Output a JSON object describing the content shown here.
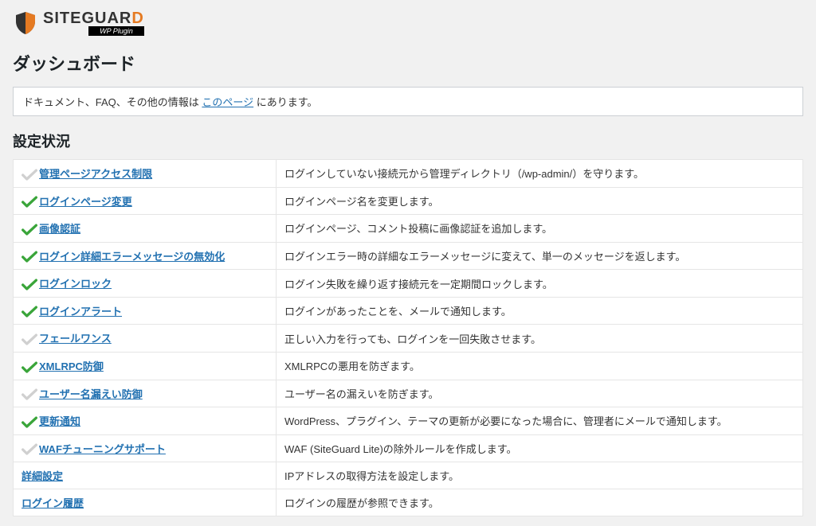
{
  "logo": {
    "brand_main": "SITEGUAR",
    "brand_accent": "D",
    "sub": "WP Plugin"
  },
  "page_title": "ダッシュボード",
  "help": {
    "prefix": "ドキュメント、FAQ、その他の情報は ",
    "link": "このページ",
    "suffix": " にあります。"
  },
  "section_title": "設定状況",
  "rows": [
    {
      "status": "off",
      "label": "管理ページアクセス制限",
      "desc": "ログインしていない接続元から管理ディレクトリ（/wp-admin/）を守ります。"
    },
    {
      "status": "on",
      "label": "ログインページ変更",
      "desc": "ログインページ名を変更します。"
    },
    {
      "status": "on",
      "label": "画像認証",
      "desc": "ログインページ、コメント投稿に画像認証を追加します。"
    },
    {
      "status": "on",
      "label": "ログイン詳細エラーメッセージの無効化",
      "desc": "ログインエラー時の詳細なエラーメッセージに変えて、単一のメッセージを返します。"
    },
    {
      "status": "on",
      "label": "ログインロック",
      "desc": "ログイン失敗を繰り返す接続元を一定期間ロックします。"
    },
    {
      "status": "on",
      "label": "ログインアラート",
      "desc": "ログインがあったことを、メールで通知します。"
    },
    {
      "status": "off",
      "label": "フェールワンス",
      "desc": "正しい入力を行っても、ログインを一回失敗させます。"
    },
    {
      "status": "on",
      "label": "XMLRPC防御",
      "desc": "XMLRPCの悪用を防ぎます。"
    },
    {
      "status": "off",
      "label": "ユーザー名漏えい防御",
      "desc": "ユーザー名の漏えいを防ぎます。"
    },
    {
      "status": "on",
      "label": "更新通知",
      "desc": "WordPress、プラグイン、テーマの更新が必要になった場合に、管理者にメールで通知します。"
    },
    {
      "status": "off",
      "label": "WAFチューニングサポート",
      "desc": "WAF (SiteGuard Lite)の除外ルールを作成します。"
    },
    {
      "status": "none",
      "label": "詳細設定",
      "desc": "IPアドレスの取得方法を設定します。"
    },
    {
      "status": "none",
      "label": "ログイン履歴",
      "desc": "ログインの履歴が参照できます。"
    }
  ]
}
